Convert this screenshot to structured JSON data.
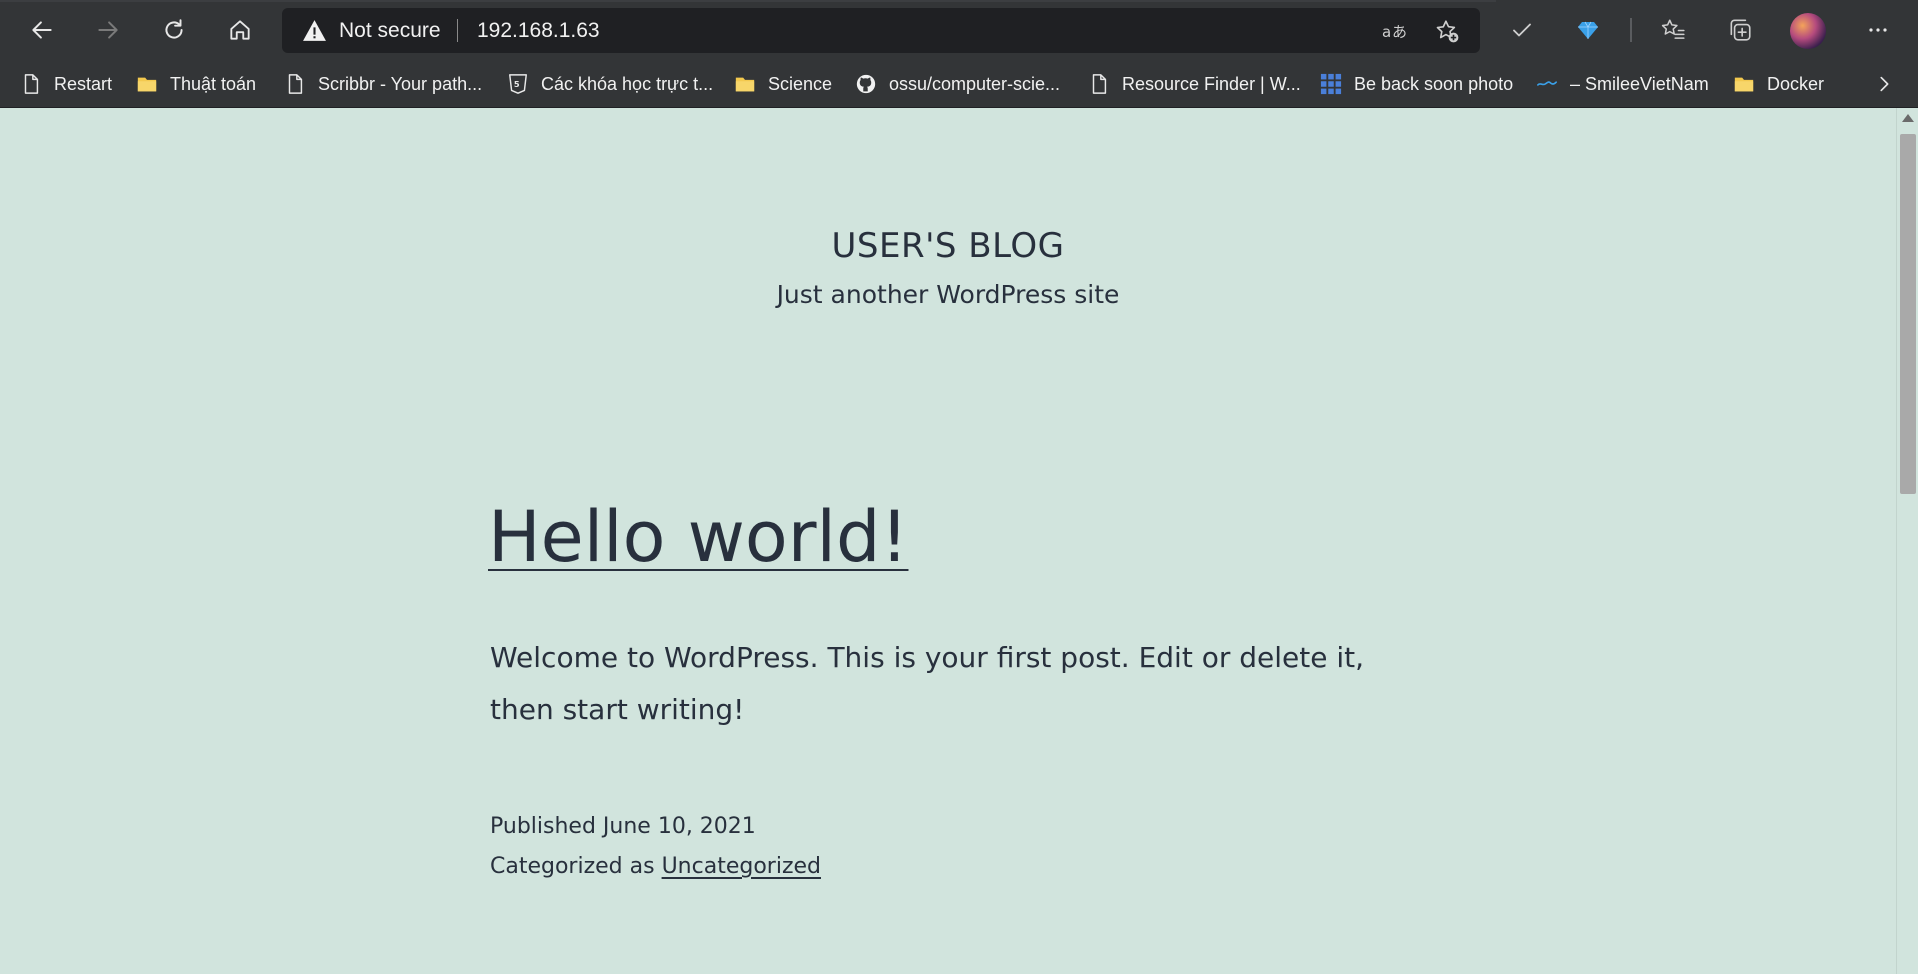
{
  "browser": {
    "security_label": "Not secure",
    "url": "192.168.1.63",
    "bookmarks": [
      {
        "label": "Restart",
        "icon": "page-icon"
      },
      {
        "label": "Thuật toán",
        "icon": "folder-icon"
      },
      {
        "label": "Scribbr - Your path...",
        "icon": "page-icon"
      },
      {
        "label": "Các khóa học trực t...",
        "icon": "html-badge-icon"
      },
      {
        "label": "Science",
        "icon": "folder-icon"
      },
      {
        "label": "ossu/computer-scie...",
        "icon": "github-icon"
      },
      {
        "label": "Resource Finder | W...",
        "icon": "page-icon"
      },
      {
        "label": "Be back soon photo",
        "icon": "grid-icon"
      },
      {
        "label": "– SmileeVietNam",
        "icon": "site-logo-icon"
      },
      {
        "label": "Docker",
        "icon": "folder-icon"
      }
    ],
    "colors": {
      "folder": "#f3c94e",
      "grid": "#4a7fd9",
      "accent_blue": "#3aa0e8"
    }
  },
  "page": {
    "site_title": "USER'S BLOG",
    "site_description": "Just another WordPress site",
    "post_title": "Hello world!",
    "post_body": "Welcome to WordPress. This is your first post. Edit or delete it, then start writing!",
    "published_prefix": "Published",
    "published_date": "June 10, 2021",
    "category_prefix": "Categorized as",
    "category": "Uncategorized",
    "background_color": "#d1e4dd",
    "text_color": "#28303d"
  }
}
